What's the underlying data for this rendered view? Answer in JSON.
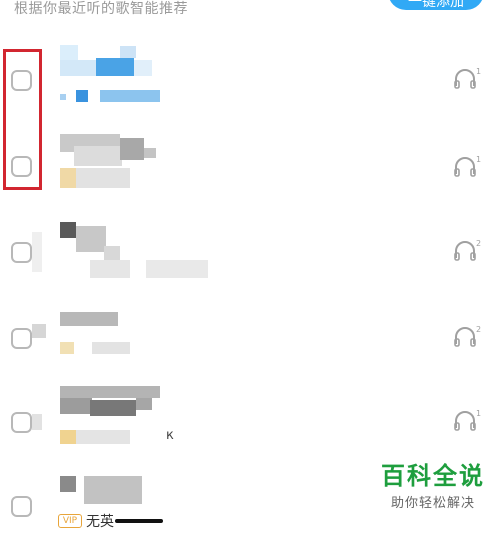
{
  "header": {
    "hint": "根据你最近听的歌智能推荐",
    "button_label": "一键添加"
  },
  "songs": [
    {
      "listen_count": "1",
      "tag": ""
    },
    {
      "listen_count": "1",
      "tag": ""
    },
    {
      "listen_count": "2",
      "tag": ""
    },
    {
      "listen_count": "2",
      "tag": ""
    },
    {
      "listen_count": "1",
      "tag": ""
    },
    {
      "listen_count": "",
      "tag": "VIP",
      "partial_title": "无英"
    }
  ],
  "watermark": {
    "title": "百科全说",
    "subtitle": "助你轻松解决"
  },
  "colors": {
    "accent": "#31a9f5",
    "highlight": "#d22630",
    "watermark": "#1e9e3e"
  },
  "icons": {
    "listen": "headphone-icon",
    "select": "checkbox-icon"
  }
}
